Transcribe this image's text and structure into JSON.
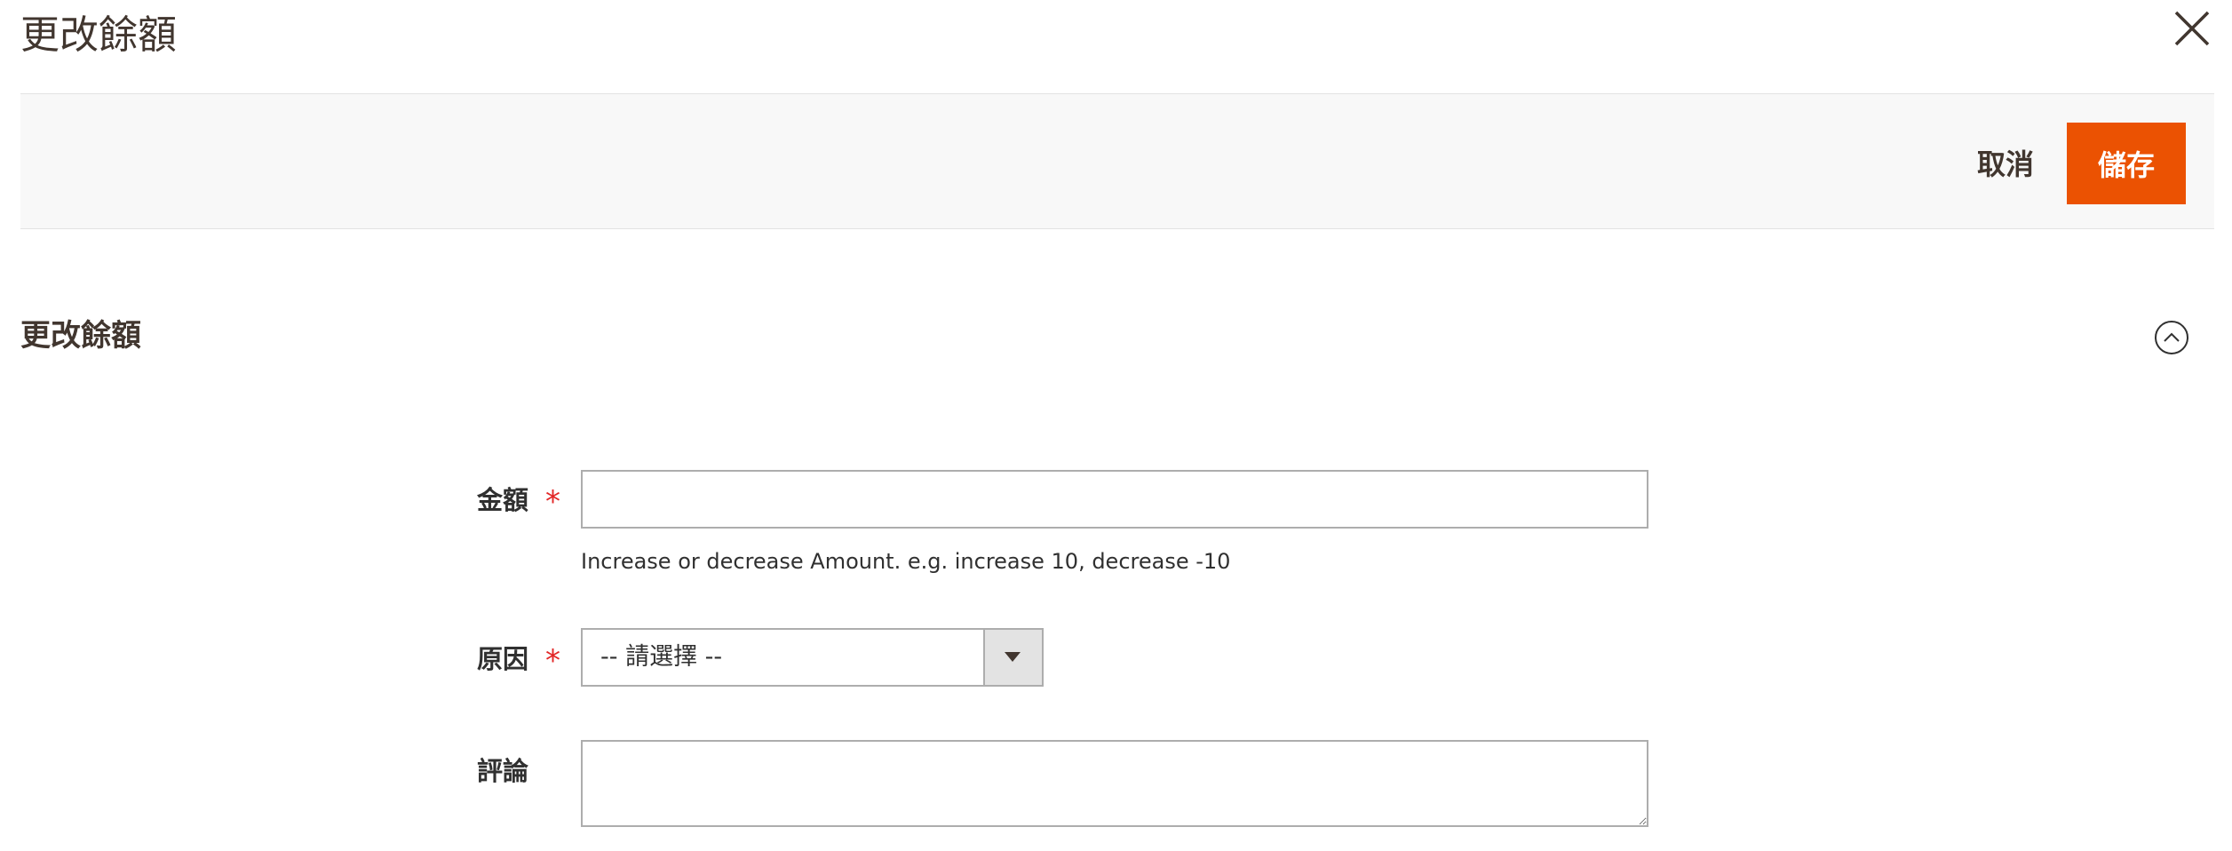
{
  "modal": {
    "title": "更改餘額"
  },
  "toolbar": {
    "cancel_label": "取消",
    "save_label": "儲存"
  },
  "section": {
    "title": "更改餘額"
  },
  "form": {
    "amount": {
      "label": "金額",
      "required_mark": "*",
      "value": "",
      "note": "Increase or decrease Amount. e.g. increase 10, decrease -10"
    },
    "reason": {
      "label": "原因",
      "required_mark": "*",
      "selected": "-- 請選擇 --"
    },
    "comment": {
      "label": "評論",
      "value": ""
    }
  },
  "colors": {
    "accent": "#eb5202",
    "required": "#e22626",
    "bar_bg": "#f8f8f8",
    "border": "#adadad"
  },
  "icons": {
    "close": "close-icon",
    "collapse": "chevron-up-circle-icon",
    "select_arrow": "caret-down-icon"
  }
}
